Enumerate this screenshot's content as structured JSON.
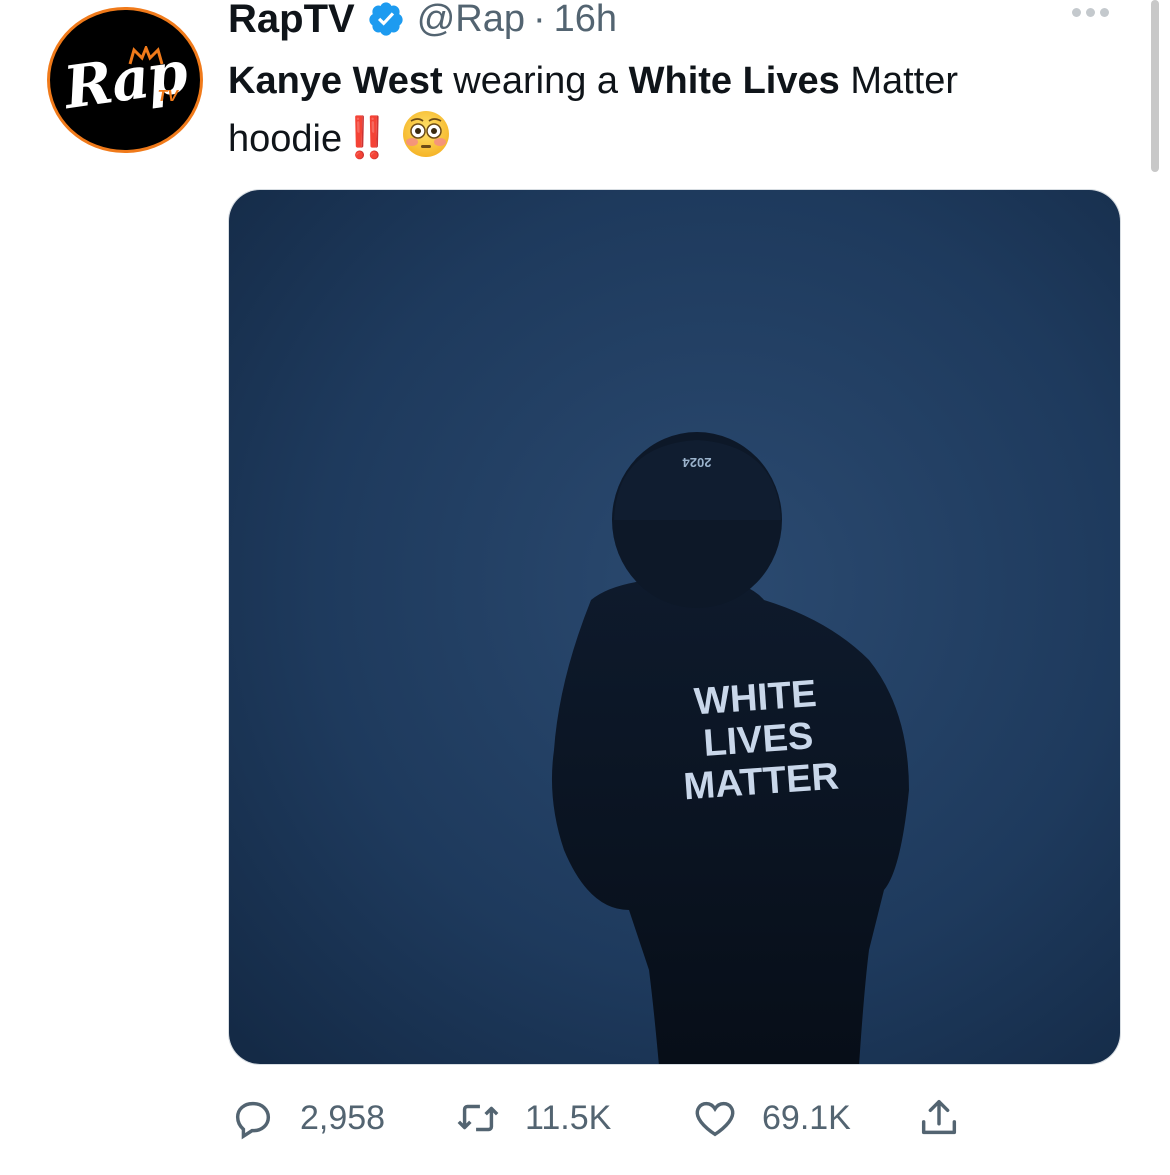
{
  "tweet": {
    "display_name": "RapTV",
    "handle": "@Rap",
    "separator": "·",
    "time": "16h",
    "text_parts": {
      "p1": "Kanye West",
      "p2": " wearing a ",
      "p3": "White Lives",
      "p4": " Matter hoodie",
      "bangs": "‼️"
    },
    "avatar": {
      "logo_text": "Rap",
      "logo_sub": "TV"
    },
    "media": {
      "hat_text": "2024",
      "hoodie_lines": [
        "WHITE",
        "LIVES",
        "MATTER"
      ]
    },
    "stats": {
      "replies": "2,958",
      "retweets": "11.5K",
      "likes": "69.1K"
    }
  },
  "icons": {
    "verified": "verified-badge-icon",
    "more": "more-dots-icon",
    "reply": "reply-bubble-icon",
    "retweet": "retweet-icon",
    "like": "heart-icon",
    "share": "share-upload-icon",
    "emoji": "flushed-face-emoji"
  },
  "colors": {
    "text": "#0f1419",
    "secondary": "#536471",
    "verified": "#1d9bf0",
    "avatar_ring": "#f07a1a",
    "media_bg": "#1c3350"
  }
}
